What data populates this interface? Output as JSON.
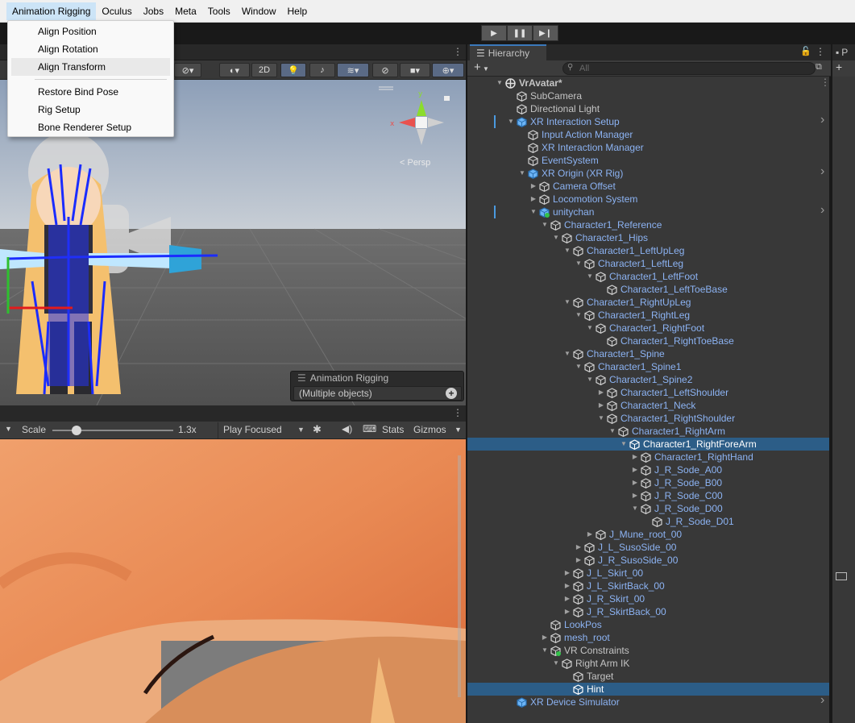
{
  "menubar": {
    "items": [
      "Animation Rigging",
      "Oculus",
      "Jobs",
      "Meta",
      "Tools",
      "Window",
      "Help"
    ]
  },
  "dropdown": {
    "group1": [
      "Align Position",
      "Align Rotation",
      "Align Transform"
    ],
    "group2": [
      "Restore Bind Pose",
      "Rig Setup",
      "Bone Renderer Setup"
    ]
  },
  "scene": {
    "toolbar_2d": "2D",
    "persp_label": "< Persp",
    "overlay": {
      "title": "Animation Rigging",
      "value": "(Multiple objects)"
    }
  },
  "game": {
    "scale_label": "Scale",
    "scale_value": "1.3x",
    "scale_fraction": 0.13,
    "play_mode": "Play Focused",
    "stats": "Stats",
    "gizmos": "Gizmos"
  },
  "hierarchy": {
    "tab": "Hierarchy",
    "search_placeholder": "All",
    "rows": [
      {
        "label": "VrAvatar*",
        "depth": 0,
        "arrow": "down",
        "icon": "unity-scene-icon",
        "type": "scene"
      },
      {
        "label": "SubCamera",
        "depth": 1,
        "arrow": "",
        "icon": "gameobject-icon",
        "type": "go"
      },
      {
        "label": "Directional Light",
        "depth": 1,
        "arrow": "",
        "icon": "gameobject-icon",
        "type": "go"
      },
      {
        "label": "XR Interaction Setup",
        "depth": 1,
        "arrow": "down",
        "icon": "prefab-icon",
        "type": "prefab",
        "chev": true,
        "hl": true
      },
      {
        "label": "Input Action Manager",
        "depth": 2,
        "arrow": "",
        "icon": "gameobject-icon",
        "type": "prefab"
      },
      {
        "label": "XR Interaction Manager",
        "depth": 2,
        "arrow": "",
        "icon": "gameobject-icon",
        "type": "prefab"
      },
      {
        "label": "EventSystem",
        "depth": 2,
        "arrow": "",
        "icon": "gameobject-icon",
        "type": "prefab"
      },
      {
        "label": "XR Origin (XR Rig)",
        "depth": 2,
        "arrow": "down",
        "icon": "prefab-icon",
        "type": "prefab",
        "chev": true
      },
      {
        "label": "Camera Offset",
        "depth": 3,
        "arrow": "right",
        "icon": "gameobject-icon",
        "type": "prefab"
      },
      {
        "label": "Locomotion System",
        "depth": 3,
        "arrow": "right",
        "icon": "gameobject-icon",
        "type": "prefab"
      },
      {
        "label": "unitychan",
        "depth": 3,
        "arrow": "down",
        "icon": "prefab-added-icon",
        "type": "prefab",
        "chev": true,
        "hl": true
      },
      {
        "label": "Character1_Reference",
        "depth": 4,
        "arrow": "down",
        "icon": "gameobject-icon",
        "type": "prefab"
      },
      {
        "label": "Character1_Hips",
        "depth": 5,
        "arrow": "down",
        "icon": "gameobject-icon",
        "type": "prefab"
      },
      {
        "label": "Character1_LeftUpLeg",
        "depth": 6,
        "arrow": "down",
        "icon": "gameobject-icon",
        "type": "prefab"
      },
      {
        "label": "Character1_LeftLeg",
        "depth": 7,
        "arrow": "down",
        "icon": "gameobject-icon",
        "type": "prefab"
      },
      {
        "label": "Character1_LeftFoot",
        "depth": 8,
        "arrow": "down",
        "icon": "gameobject-icon",
        "type": "prefab"
      },
      {
        "label": "Character1_LeftToeBase",
        "depth": 9,
        "arrow": "",
        "icon": "gameobject-icon",
        "type": "prefab"
      },
      {
        "label": "Character1_RightUpLeg",
        "depth": 6,
        "arrow": "down",
        "icon": "gameobject-icon",
        "type": "prefab"
      },
      {
        "label": "Character1_RightLeg",
        "depth": 7,
        "arrow": "down",
        "icon": "gameobject-icon",
        "type": "prefab"
      },
      {
        "label": "Character1_RightFoot",
        "depth": 8,
        "arrow": "down",
        "icon": "gameobject-icon",
        "type": "prefab"
      },
      {
        "label": "Character1_RightToeBase",
        "depth": 9,
        "arrow": "",
        "icon": "gameobject-icon",
        "type": "prefab"
      },
      {
        "label": "Character1_Spine",
        "depth": 6,
        "arrow": "down",
        "icon": "gameobject-icon",
        "type": "prefab"
      },
      {
        "label": "Character1_Spine1",
        "depth": 7,
        "arrow": "down",
        "icon": "gameobject-icon",
        "type": "prefab"
      },
      {
        "label": "Character1_Spine2",
        "depth": 8,
        "arrow": "down",
        "icon": "gameobject-icon",
        "type": "prefab"
      },
      {
        "label": "Character1_LeftShoulder",
        "depth": 9,
        "arrow": "right",
        "icon": "gameobject-icon",
        "type": "prefab"
      },
      {
        "label": "Character1_Neck",
        "depth": 9,
        "arrow": "right",
        "icon": "gameobject-icon",
        "type": "prefab"
      },
      {
        "label": "Character1_RightShoulder",
        "depth": 9,
        "arrow": "down",
        "icon": "gameobject-icon",
        "type": "prefab"
      },
      {
        "label": "Character1_RightArm",
        "depth": 10,
        "arrow": "down",
        "icon": "gameobject-icon",
        "type": "prefab"
      },
      {
        "label": "Character1_RightForeArm",
        "depth": 11,
        "arrow": "down",
        "icon": "gameobject-icon",
        "type": "prefab",
        "selected": true
      },
      {
        "label": "Character1_RightHand",
        "depth": 12,
        "arrow": "right",
        "icon": "gameobject-icon",
        "type": "prefab"
      },
      {
        "label": "J_R_Sode_A00",
        "depth": 12,
        "arrow": "right",
        "icon": "gameobject-icon",
        "type": "prefab"
      },
      {
        "label": "J_R_Sode_B00",
        "depth": 12,
        "arrow": "right",
        "icon": "gameobject-icon",
        "type": "prefab"
      },
      {
        "label": "J_R_Sode_C00",
        "depth": 12,
        "arrow": "right",
        "icon": "gameobject-icon",
        "type": "prefab"
      },
      {
        "label": "J_R_Sode_D00",
        "depth": 12,
        "arrow": "down",
        "icon": "gameobject-icon",
        "type": "prefab"
      },
      {
        "label": "J_R_Sode_D01",
        "depth": 13,
        "arrow": "",
        "icon": "gameobject-icon",
        "type": "prefab"
      },
      {
        "label": "J_Mune_root_00",
        "depth": 8,
        "arrow": "right",
        "icon": "gameobject-icon",
        "type": "prefab"
      },
      {
        "label": "J_L_SusoSide_00",
        "depth": 7,
        "arrow": "right",
        "icon": "gameobject-icon",
        "type": "prefab"
      },
      {
        "label": "J_R_SusoSide_00",
        "depth": 7,
        "arrow": "right",
        "icon": "gameobject-icon",
        "type": "prefab"
      },
      {
        "label": "J_L_Skirt_00",
        "depth": 6,
        "arrow": "right",
        "icon": "gameobject-icon",
        "type": "prefab"
      },
      {
        "label": "J_L_SkirtBack_00",
        "depth": 6,
        "arrow": "right",
        "icon": "gameobject-icon",
        "type": "prefab"
      },
      {
        "label": "J_R_Skirt_00",
        "depth": 6,
        "arrow": "right",
        "icon": "gameobject-icon",
        "type": "prefab"
      },
      {
        "label": "J_R_SkirtBack_00",
        "depth": 6,
        "arrow": "right",
        "icon": "gameobject-icon",
        "type": "prefab"
      },
      {
        "label": "LookPos",
        "depth": 4,
        "arrow": "",
        "icon": "gameobject-icon",
        "type": "prefab"
      },
      {
        "label": "mesh_root",
        "depth": 4,
        "arrow": "right",
        "icon": "gameobject-icon",
        "type": "prefab"
      },
      {
        "label": "VR Constraints",
        "depth": 4,
        "arrow": "down",
        "icon": "gameobject-added-icon",
        "type": "go"
      },
      {
        "label": "Right Arm IK",
        "depth": 5,
        "arrow": "down",
        "icon": "gameobject-icon",
        "type": "go"
      },
      {
        "label": "Target",
        "depth": 6,
        "arrow": "",
        "icon": "gameobject-icon",
        "type": "go"
      },
      {
        "label": "Hint",
        "depth": 6,
        "arrow": "",
        "icon": "gameobject-icon",
        "type": "go",
        "selected": true
      },
      {
        "label": "XR Device Simulator",
        "depth": 1,
        "arrow": "",
        "icon": "prefab-icon",
        "type": "prefab",
        "chev": true
      }
    ]
  },
  "inspector": {
    "tab_initial": "P"
  },
  "colors": {
    "selection": "#2c5d87",
    "prefab_text": "#8cb3f3",
    "prefab_icon": "#6cb4f5"
  }
}
